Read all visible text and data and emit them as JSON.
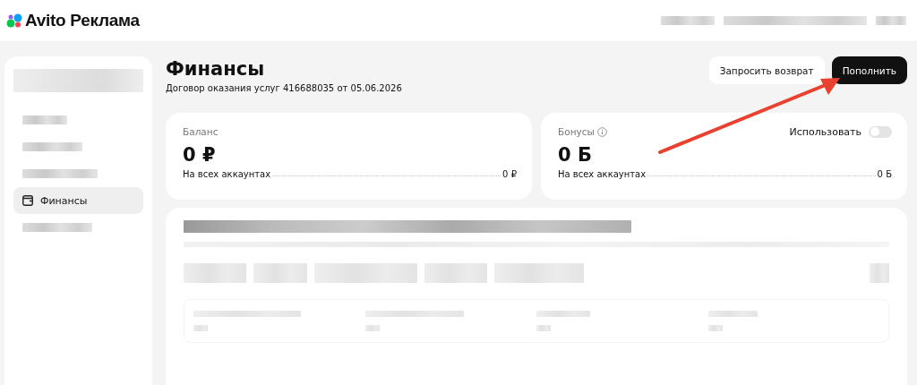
{
  "header": {
    "logo_text": "Avito Реклама"
  },
  "sidebar": {
    "items": [
      {
        "kind": "redacted",
        "selected": false
      },
      {
        "kind": "redacted",
        "selected": false
      },
      {
        "kind": "redacted",
        "selected": false
      },
      {
        "kind": "label",
        "label": "Финансы",
        "selected": true
      },
      {
        "kind": "redacted",
        "selected": false
      }
    ]
  },
  "page": {
    "title": "Финансы",
    "subtitle": "Договор оказания услуг 416688035 от 05.06.2026",
    "buttons": [
      {
        "label": "Запросить возврат",
        "kind": "secondary"
      },
      {
        "label": "Пополнить",
        "kind": "primary"
      }
    ]
  },
  "cards": [
    {
      "kind": "balance",
      "title": "Баланс",
      "amount": "0 ₽",
      "row_label": "На всех аккаунтах",
      "row_value": "0 ₽"
    },
    {
      "kind": "bonus",
      "title": "Бонусы",
      "amount": "0 Б",
      "row_label": "На всех аккаунтах",
      "row_value": "0 Б",
      "toggle": {
        "label": "Использовать",
        "on": false
      }
    }
  ]
}
